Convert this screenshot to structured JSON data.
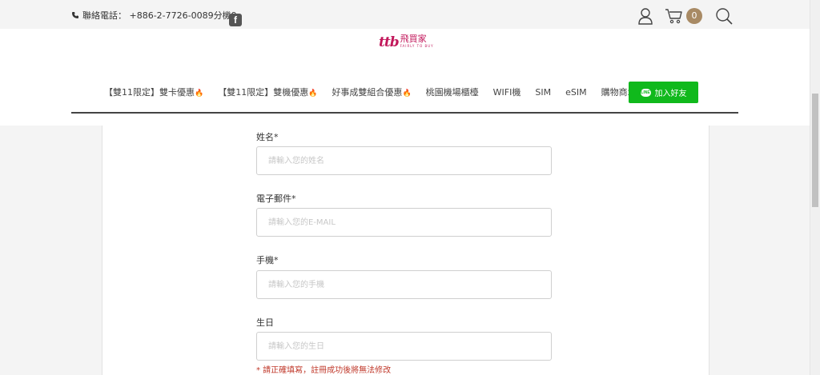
{
  "topbar": {
    "phone_label": "聯絡電話： +886-2-7726-0089分機9",
    "facebook_icon_text": "f",
    "cart_count": "0"
  },
  "logo": {
    "script": "ttb",
    "name": "飛買家",
    "tagline": "FAIRLY TO BUY"
  },
  "nav": {
    "items": [
      {
        "label": "【雙11限定】雙卡優惠",
        "fire": true
      },
      {
        "label": "【雙11限定】雙機優惠",
        "fire": true
      },
      {
        "label": "好事成雙組合優惠",
        "fire": true
      },
      {
        "label": "桃園機場櫃檯",
        "fire": false
      },
      {
        "label": "WIFI機",
        "fire": false
      },
      {
        "label": "SIM",
        "fire": false
      },
      {
        "label": "eSIM",
        "fire": false
      },
      {
        "label": "購物商城",
        "fire": false
      }
    ],
    "line_button": {
      "logo": "LINE",
      "label": "加入好友"
    }
  },
  "form": {
    "name": {
      "label": "姓名*",
      "placeholder": "請輸入您的姓名"
    },
    "email": {
      "label": "電子郵件*",
      "placeholder": "請輸入您的E-MAIL"
    },
    "phone": {
      "label": "手機*",
      "placeholder": "請輸入您的手機"
    },
    "birthday": {
      "label": "生日",
      "placeholder": "請輸入您的生日"
    },
    "note": "* 請正確填寫，註冊成功後將無法修改"
  },
  "colors": {
    "accent_brand": "#c2185b",
    "line_green": "#10b91c",
    "cart_badge": "#a88a64",
    "warning_text": "#c0392b"
  }
}
